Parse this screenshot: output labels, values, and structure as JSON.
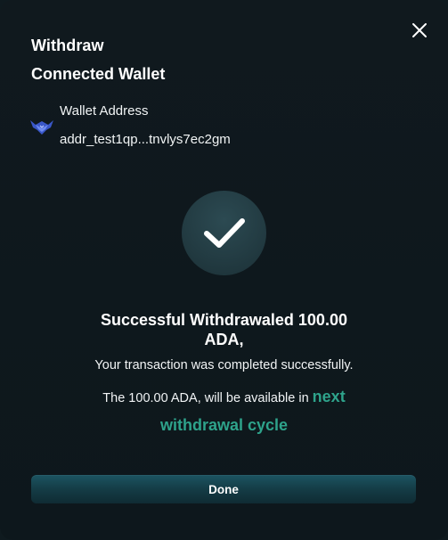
{
  "modal": {
    "title": "Withdraw",
    "subtitle": "Connected Wallet",
    "close_icon": "close-icon"
  },
  "wallet": {
    "label": "Wallet Address",
    "address": "addr_test1qp...tnvlys7ec2gm",
    "icon": "wallet-logo-icon"
  },
  "success": {
    "icon": "checkmark-icon",
    "title_line1": "Successful Withdrawaled 100.00",
    "title_line2": "ADA,",
    "message": "Your transaction was completed successfully.",
    "availability_prefix": "The 100.00 ADA, will be available in",
    "availability_highlight_1": "next",
    "availability_highlight_2": "withdrawal cycle"
  },
  "actions": {
    "done_label": "Done"
  },
  "colors": {
    "background": "#0f1a1f",
    "accent_green": "#2ea38b",
    "button": "#153e48",
    "check_circle": "#233c43"
  }
}
